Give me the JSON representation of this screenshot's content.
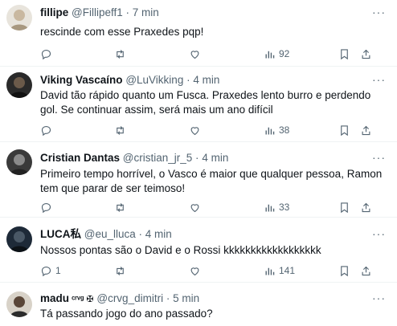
{
  "tweets": [
    {
      "name": "fillipe",
      "handle": "@Fillipeff1",
      "sep": "·",
      "time": "7 min",
      "text": "rescinde com esse Praxedes pqp!",
      "reply_count": "",
      "retweet_count": "",
      "like_count": "",
      "views": "92"
    },
    {
      "name": "Viking Vascaíno",
      "handle": "@LuVikking",
      "sep": "·",
      "time": "4 min",
      "text": "David tão rápido quanto um Fusca. Praxedes lento burro e perdendo gol. Se continuar assim, será mais um ano difícil",
      "reply_count": "",
      "retweet_count": "",
      "like_count": "",
      "views": "38"
    },
    {
      "name": "Cristian Dantas",
      "handle": "@cristian_jr_5",
      "sep": "·",
      "time": "4 min",
      "text": "Primeiro tempo horrível, o Vasco é maior que qualquer pessoa, Ramon tem que parar de ser teimoso!",
      "reply_count": "",
      "retweet_count": "",
      "like_count": "",
      "views": "33"
    },
    {
      "name": "LUCA私",
      "handle": "@eu_lluca",
      "sep": "·",
      "time": "4 min",
      "text": "Nossos pontas são o David e o Rossi kkkkkkkkkkkkkkkkkk",
      "reply_count": "1",
      "retweet_count": "",
      "like_count": "",
      "views": "141"
    },
    {
      "name": "madu",
      "name_suffix": " ᶜʳᵛᵍ ✠",
      "handle": "@crvg_dimitri",
      "sep": "·",
      "time": "5 min",
      "text": "Tá passando jogo do ano passado?"
    }
  ],
  "more_label": "···",
  "colors": {
    "text": "#0f1419",
    "secondary": "#536471",
    "divider": "#eff3f4"
  },
  "icons": [
    "reply-icon",
    "retweet-icon",
    "like-icon",
    "views-icon",
    "bookmark-icon",
    "share-icon",
    "more-icon"
  ]
}
